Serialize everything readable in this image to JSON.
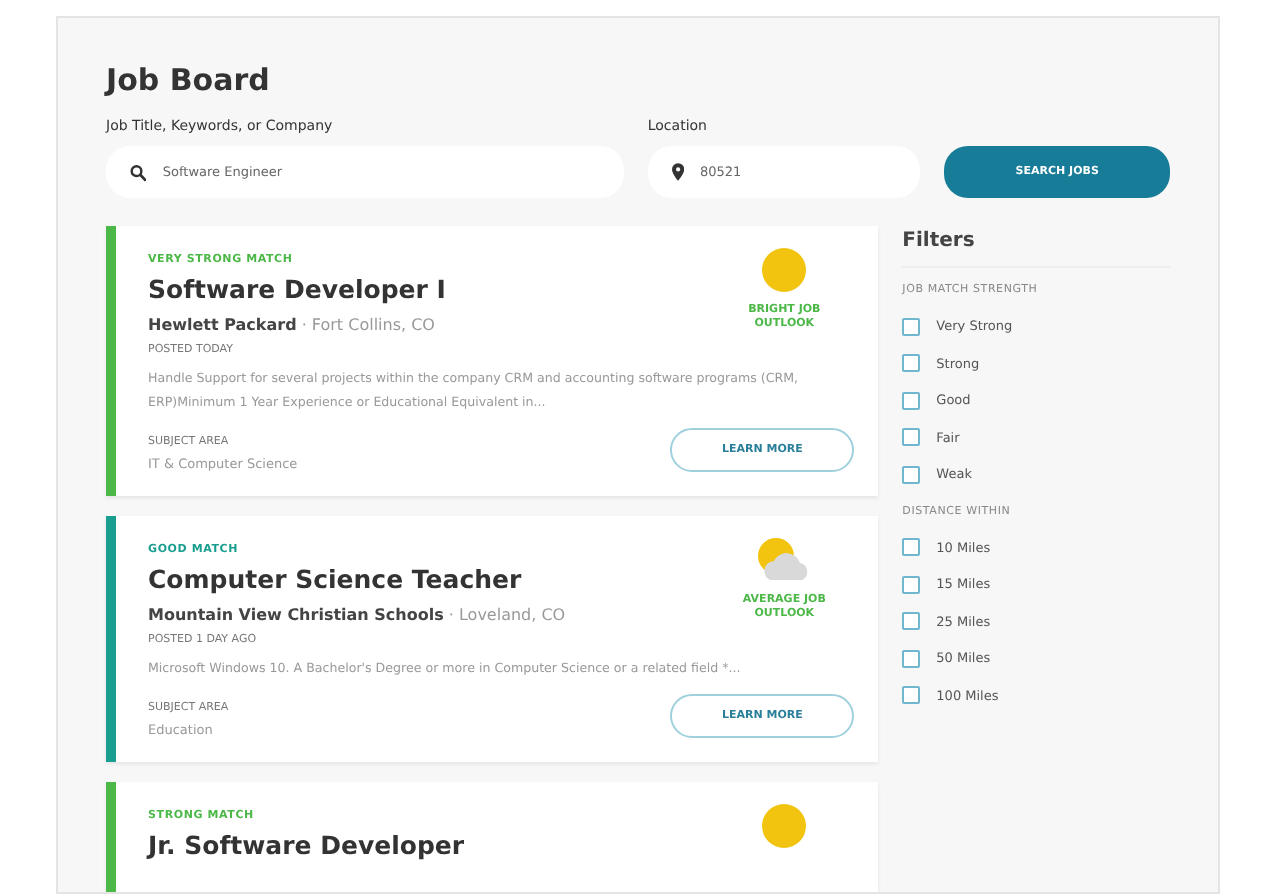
{
  "title": "Job Board",
  "search": {
    "keyword_label": "Job Title, Keywords, or Company",
    "keyword_value": "Software Engineer",
    "location_label": "Location",
    "location_value": "80521",
    "button": "SEARCH JOBS"
  },
  "jobs": [
    {
      "match": "VERY STRONG MATCH",
      "color": "#4cb848",
      "title": "Software Developer I",
      "company": "Hewlett Packard",
      "location": "· Fort Collins, CO",
      "posted": "POSTED TODAY",
      "description": "Handle Support for several projects within the company CRM and accounting software programs (CRM, ERP)Minimum 1 Year Experience or Educational Equivalent in...",
      "subject_label": "SUBJECT AREA",
      "subject": "IT & Computer Science",
      "kind": "bright",
      "outlook": "BRIGHT JOB OUTLOOK",
      "button": "LEARN MORE"
    },
    {
      "match": "GOOD MATCH",
      "color": "#1a9e8f",
      "title": "Computer Science Teacher",
      "company": "Mountain View Christian Schools",
      "location": "· Loveland, CO",
      "posted": "POSTED 1 DAY AGO",
      "description": "Microsoft Windows 10. A Bachelor's Degree or more in Computer Science or a related field *...",
      "subject_label": "SUBJECT AREA",
      "subject": "Education",
      "kind": "average",
      "outlook": "AVERAGE JOB OUTLOOK",
      "button": "LEARN MORE"
    },
    {
      "match": "STRONG MATCH",
      "color": "#4cb848",
      "title": "Jr. Software Developer",
      "kind": "bright"
    }
  ],
  "filters": {
    "title": "Filters",
    "groups": [
      {
        "heading": "JOB MATCH STRENGTH",
        "options": [
          {
            "label": "Very Strong",
            "checked": false
          },
          {
            "label": "Strong",
            "checked": false
          },
          {
            "label": "Good",
            "checked": false
          },
          {
            "label": "Fair",
            "checked": false
          },
          {
            "label": "Weak",
            "checked": false
          }
        ]
      },
      {
        "heading": "DISTANCE WITHIN",
        "options": [
          {
            "label": "10 Miles",
            "checked": false
          },
          {
            "label": "15 Miles",
            "checked": false
          },
          {
            "label": "25 Miles",
            "checked": false
          },
          {
            "label": "50 Miles",
            "checked": false
          },
          {
            "label": "100 Miles",
            "checked": false
          }
        ]
      }
    ]
  }
}
